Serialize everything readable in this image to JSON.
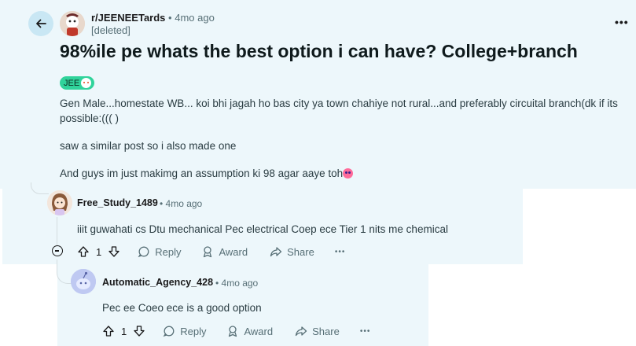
{
  "post": {
    "subreddit": "r/JEENEETards",
    "separator": "•",
    "time": "4mo ago",
    "author": "[deleted]",
    "title": "98%ile pe whats the best option i can have? College+branch",
    "flair": "JEE",
    "paragraphs": [
      "Gen Male...homestate WB... koi bhi jagah ho bas city ya town chahiye not rural...and preferably circuital branch(dk if its possible:((( )",
      "saw a similar post so i also made one",
      "And guys im just makimg an assumption ki 98 agar aaye toh"
    ],
    "more_label": "•••"
  },
  "comments": [
    {
      "author": "Free_Study_1489",
      "time": "• 4mo ago",
      "text": "iiit guwahati cs Dtu mechanical Pec electrical Coep ece Tier 1 nits me chemical",
      "score": "1",
      "reply_label": "Reply",
      "award_label": "Award",
      "share_label": "Share",
      "more_label": "•••"
    },
    {
      "author": "Automatic_Agency_428",
      "time": "• 4mo ago",
      "text": "Pec ee Coeo ece is a good option",
      "score": "1",
      "reply_label": "Reply",
      "award_label": "Award",
      "share_label": "Share",
      "more_label": "•••"
    }
  ],
  "icons": {
    "back": "arrow-left-icon",
    "upvote": "arrow-up-icon",
    "downvote": "arrow-down-icon",
    "reply": "speech-bubble-icon",
    "award": "award-icon",
    "share": "share-arrow-icon",
    "collapse": "minus-circle-icon"
  },
  "colors": {
    "post_background": "#edf7fb",
    "back_button": "#c9e7f4",
    "flair": "#30d39b",
    "muted_text": "#576f76"
  }
}
